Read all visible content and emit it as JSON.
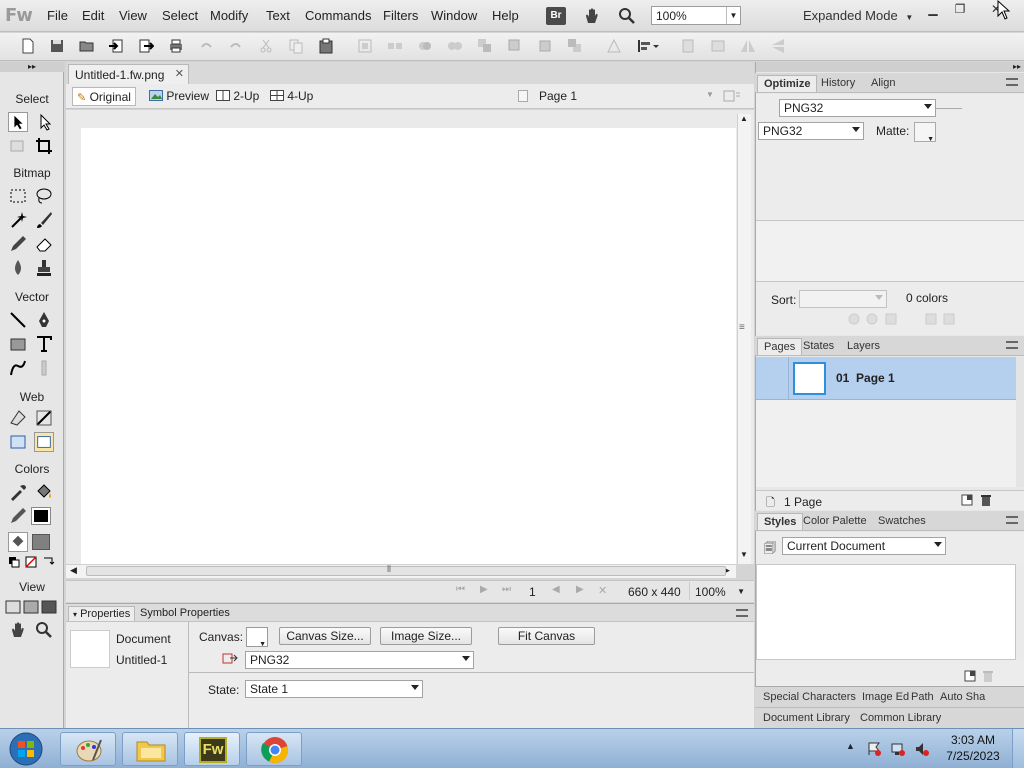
{
  "app": {
    "logo": "Fw",
    "menus": [
      "File",
      "Edit",
      "View",
      "Select",
      "Modify",
      "Text",
      "Commands",
      "Filters",
      "Window",
      "Help"
    ],
    "bridge_label": "Br",
    "zoom": "100%",
    "workspace_mode": "Expanded Mode"
  },
  "tools": {
    "sections": [
      "Select",
      "Bitmap",
      "Vector",
      "Web",
      "Colors",
      "View"
    ],
    "fill_color": "#000000"
  },
  "document": {
    "tab_title": "Untitled-1.fw.png",
    "views": [
      "Original",
      "Preview",
      "2-Up",
      "4-Up"
    ],
    "page_selector": "Page 1",
    "status": {
      "frame": "1",
      "size": "660 x 440",
      "zoom": "100%"
    }
  },
  "properties": {
    "tabs": [
      "Properties",
      "Symbol Properties"
    ],
    "doc_type": "Document",
    "doc_name": "Untitled-1",
    "canvas_label": "Canvas:",
    "canvas_size_btn": "Canvas Size...",
    "image_size_btn": "Image Size...",
    "fit_canvas_btn": "Fit Canvas",
    "format": "PNG32",
    "state_label": "State:",
    "state_value": "State 1"
  },
  "optimize": {
    "tabs": [
      "Optimize",
      "History",
      "Align"
    ],
    "preset": "PNG32",
    "format": "PNG32",
    "matte_label": "Matte:",
    "sort_label": "Sort:",
    "colors_count": "0 colors"
  },
  "pages": {
    "tabs": [
      "Pages",
      "States",
      "Layers"
    ],
    "items": [
      {
        "label": "01  Page 1"
      }
    ],
    "count_label": "1 Page"
  },
  "styles": {
    "tabs": [
      "Styles",
      "Color Palette",
      "Swatches"
    ],
    "library_select": "Current Document"
  },
  "bottom_tabs": {
    "row1": [
      "Special Characters",
      "Image Ed",
      "Path",
      "Auto Sha"
    ],
    "row2": [
      "Document Library",
      "Common Library"
    ]
  },
  "taskbar": {
    "time": "3:03 AM",
    "date": "7/25/2023",
    "fw_label": "Fw"
  }
}
